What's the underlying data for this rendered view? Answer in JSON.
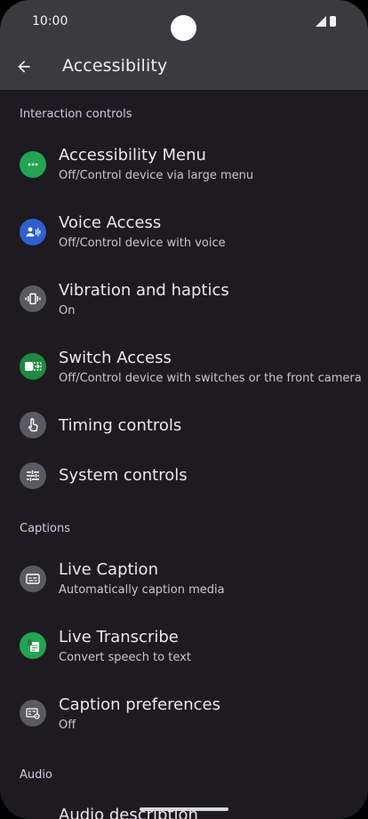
{
  "status": {
    "time": "10:00"
  },
  "header": {
    "title": "Accessibility"
  },
  "sections": {
    "interaction": "Interaction controls",
    "captions": "Captions",
    "audio": "Audio"
  },
  "items": {
    "accessibility_menu": {
      "title": "Accessibility Menu",
      "subtitle": "Off/Control device via large menu"
    },
    "voice_access": {
      "title": "Voice Access",
      "subtitle": "Off/Control device with voice"
    },
    "vibration": {
      "title": "Vibration and haptics",
      "subtitle": "On"
    },
    "switch_access": {
      "title": "Switch Access",
      "subtitle": "Off/Control device with switches or the front camera"
    },
    "timing": {
      "title": "Timing controls"
    },
    "system": {
      "title": "System controls"
    },
    "live_caption": {
      "title": "Live Caption",
      "subtitle": "Automatically caption media"
    },
    "live_transcribe": {
      "title": "Live Transcribe",
      "subtitle": "Convert speech to text"
    },
    "caption_prefs": {
      "title": "Caption preferences",
      "subtitle": "Off"
    },
    "audio_description": {
      "title": "Audio description"
    }
  },
  "colors": {
    "background": "#1d1b20",
    "top_bar": "#3b3a3e",
    "accent_green": "#22a453",
    "accent_blue": "#2e5fcd",
    "icon_gray": "#5b5a60"
  }
}
